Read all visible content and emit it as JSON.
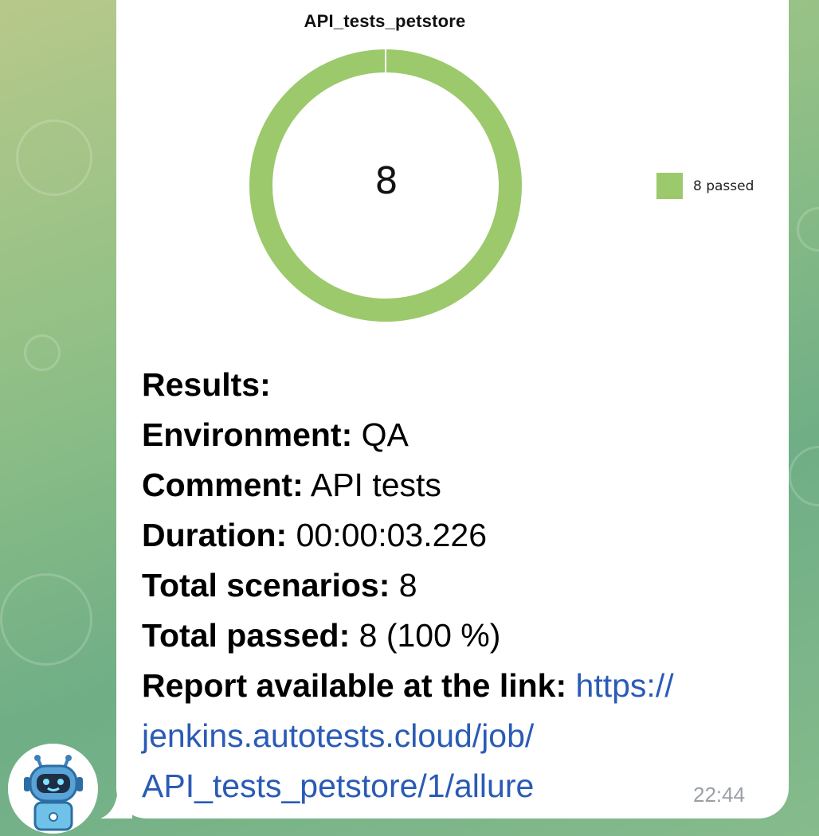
{
  "chart_data": {
    "type": "pie",
    "title": "API_tests_petstore",
    "center_label": "8",
    "slices": [
      {
        "label": "8 passed",
        "value": 8,
        "color": "#9cc96b"
      }
    ]
  },
  "message": {
    "results_label": "Results:",
    "environment_label": "Environment:",
    "environment_value": "QA",
    "comment_label": "Comment:",
    "comment_value": "API tests",
    "duration_label": "Duration:",
    "duration_value": "00:00:03.226",
    "total_scenarios_label": "Total scenarios:",
    "total_scenarios_value": "8",
    "total_passed_label": "Total passed:",
    "total_passed_value": "8 (100 %)",
    "report_label": "Report available at the link:",
    "report_link_line1": "https://",
    "report_link_line2": "jenkins.autotests.cloud/job/",
    "report_link_line3": "API_tests_petstore/1/allure",
    "time": "22:44"
  },
  "colors": {
    "passed": "#9cc96b",
    "link": "#2a5bb5"
  },
  "icons": {
    "avatar": "robot-avatar-icon"
  }
}
